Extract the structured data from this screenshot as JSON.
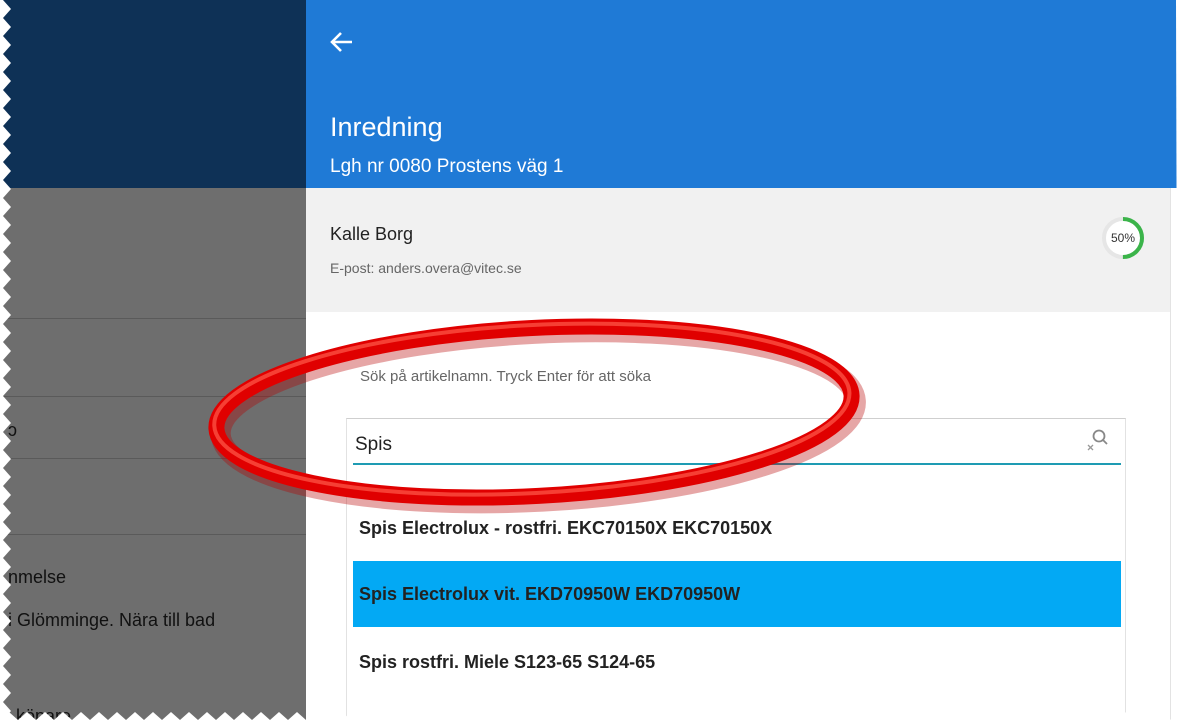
{
  "background": {
    "fragments": [
      "ɔ",
      "nmelse",
      "i Glömminge. Nära till bad",
      "köpare"
    ]
  },
  "dialog": {
    "title": "Inredning",
    "subtitle": "Lgh nr 0080 Prostens väg 1",
    "back_icon": "arrow-left-icon"
  },
  "user": {
    "name": "Kalle Borg",
    "email": "E-post: anders.overa@vitec.se",
    "progress_percent": 50,
    "progress_label": "50%"
  },
  "search": {
    "hint": "Sök på artikelnamn. Tryck Enter för att söka",
    "value": "Spis",
    "icon": "search-clear-icon"
  },
  "results": [
    {
      "label": "Spis Electrolux - rostfri. EKC70150X EKC70150X",
      "selected": false
    },
    {
      "label": "Spis Electrolux vit. EKD70950W EKD70950W",
      "selected": true
    },
    {
      "label": "Spis rostfri. Miele S123-65 S124-65",
      "selected": false
    }
  ],
  "colors": {
    "header_blue": "#1f7ad6",
    "background_header": "#0e3156",
    "selected_row": "#03a9f4",
    "progress_green": "#3bb44a",
    "annotation_red": "#e00000"
  }
}
